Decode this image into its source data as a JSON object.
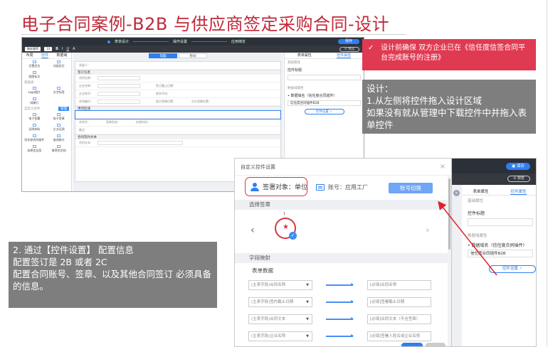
{
  "slide_title": "电子合同案例-B2B 与供应商签定采购合同-设计",
  "callout_pink": "设计前确保 双方企业已在《信任度信签合同平台完成账号的注册》",
  "callout_pink_icon": "check-icon",
  "callout_design": {
    "line1": "设计：",
    "line2": "1.从左侧将控件拖入设计区域",
    "line3": "如果没有就从管理中下载控件中并拖入表单控件"
  },
  "callout_config": {
    "line1": "2.  通过【控件设置】 配置信息",
    "line2": "配置签订是 2B 或者 2C",
    "line3": "配置合同账号、签章、以及其他合同签订 必须具备 的信息。"
  },
  "designer": {
    "steps": [
      "表单设计",
      "操作设置",
      "应用绑定"
    ],
    "save_label": "保存",
    "preview_label": "预览",
    "font_select": "微软雅黑",
    "font_size": "14",
    "toolbar_glyphs": [
      "B",
      "I",
      "U",
      "A"
    ],
    "left_tabs": [
      "布局",
      "控件",
      "数据域"
    ],
    "left_sections": {
      "basic": "基础类",
      "custom": "自定义控件",
      "manage": "管理"
    },
    "left_items": [
      {
        "label": "位置定位"
      },
      {
        "label": "动画定位"
      },
      {
        "label": "组图标注"
      },
      {
        "label": "Logo图片"
      },
      {
        "label": "文字标签"
      },
      {
        "label": "闲聊行"
      },
      {
        "label": "电子签署"
      },
      {
        "label": "电子签章"
      },
      {
        "label": "证明材料"
      },
      {
        "label": "企业证照"
      },
      {
        "label": "信任度合同插件"
      },
      {
        "label": "查询统计"
      },
      {
        "label": "选择会议室"
      },
      {
        "label": "推荐的文档"
      }
    ],
    "device_buttons": [
      "电脑",
      "移动"
    ],
    "doc_sections": [
      "签订信息",
      "用印区域",
      "合同签约文本"
    ],
    "doc_fields": {
      "contract_name": "合同名称：",
      "company_name": "企业名称：",
      "sign_deadline": "签订截止日期：",
      "company_account": "企业账号：",
      "contact_phone": "联系手机：",
      "contract_no": "合同编号：",
      "our_sign_pos": "我方签章位置：",
      "their_sign_pos": "对方签章位置：",
      "creator": "发起人：",
      "contract_no2": "合同号：",
      "seal_status": "签章状态：",
      "handle_time": "办理时间：",
      "remark": "备注：",
      "contract_text": "合同文本："
    },
    "right_tabs": [
      "表单属性",
      "控件属性"
    ],
    "right_basic": "基础属性",
    "right_ctrl_title_label": "控件标题",
    "right_ctrl_title_value": "",
    "right_data_label": "数据域属性",
    "right_data_name": "• 数据域名（信任度合同插件）",
    "right_data_value": "信任度合同插件B2B",
    "right_btn": "控件设置 ✓"
  },
  "dialog": {
    "title": "自定义控件设置",
    "signer_label": "签署对象：单位",
    "account_label": "账号：应用工厂",
    "switch_btn": "账号切换",
    "select_seal": "选择签章",
    "seal_page": "1",
    "field_map": "字段映射",
    "form_data": "表单数据",
    "mappings": [
      {
        "from": "(主表字段)合同名称",
        "to": "[必填]合同名称"
      },
      {
        "from": "(主表字段)签约截止日期",
        "to": "[必填]签署截止日期"
      },
      {
        "from": "(主表字段)合同文本",
        "to": "[必填]合同文本（不含签章）"
      },
      {
        "from": "(主表字段)企业名称",
        "to": "[必填]签署人姓名或企业名称"
      }
    ]
  },
  "panel_crop": {
    "save": "保存",
    "preview": "预览",
    "tabs": [
      "表单属性",
      "控件属性"
    ],
    "basic": "基础属性",
    "ctrl_title": "控件标题",
    "data_attr": "数据域属性",
    "data_name": "• 数据域名（信任度合同插件）",
    "data_value": "信任度合同插件B2B",
    "btn": "控件设置 ✓"
  },
  "colors": {
    "title": "#c0283a",
    "pink": "#e03a52",
    "gray": "#7e7e7e",
    "accent": "#2f7ff0"
  }
}
